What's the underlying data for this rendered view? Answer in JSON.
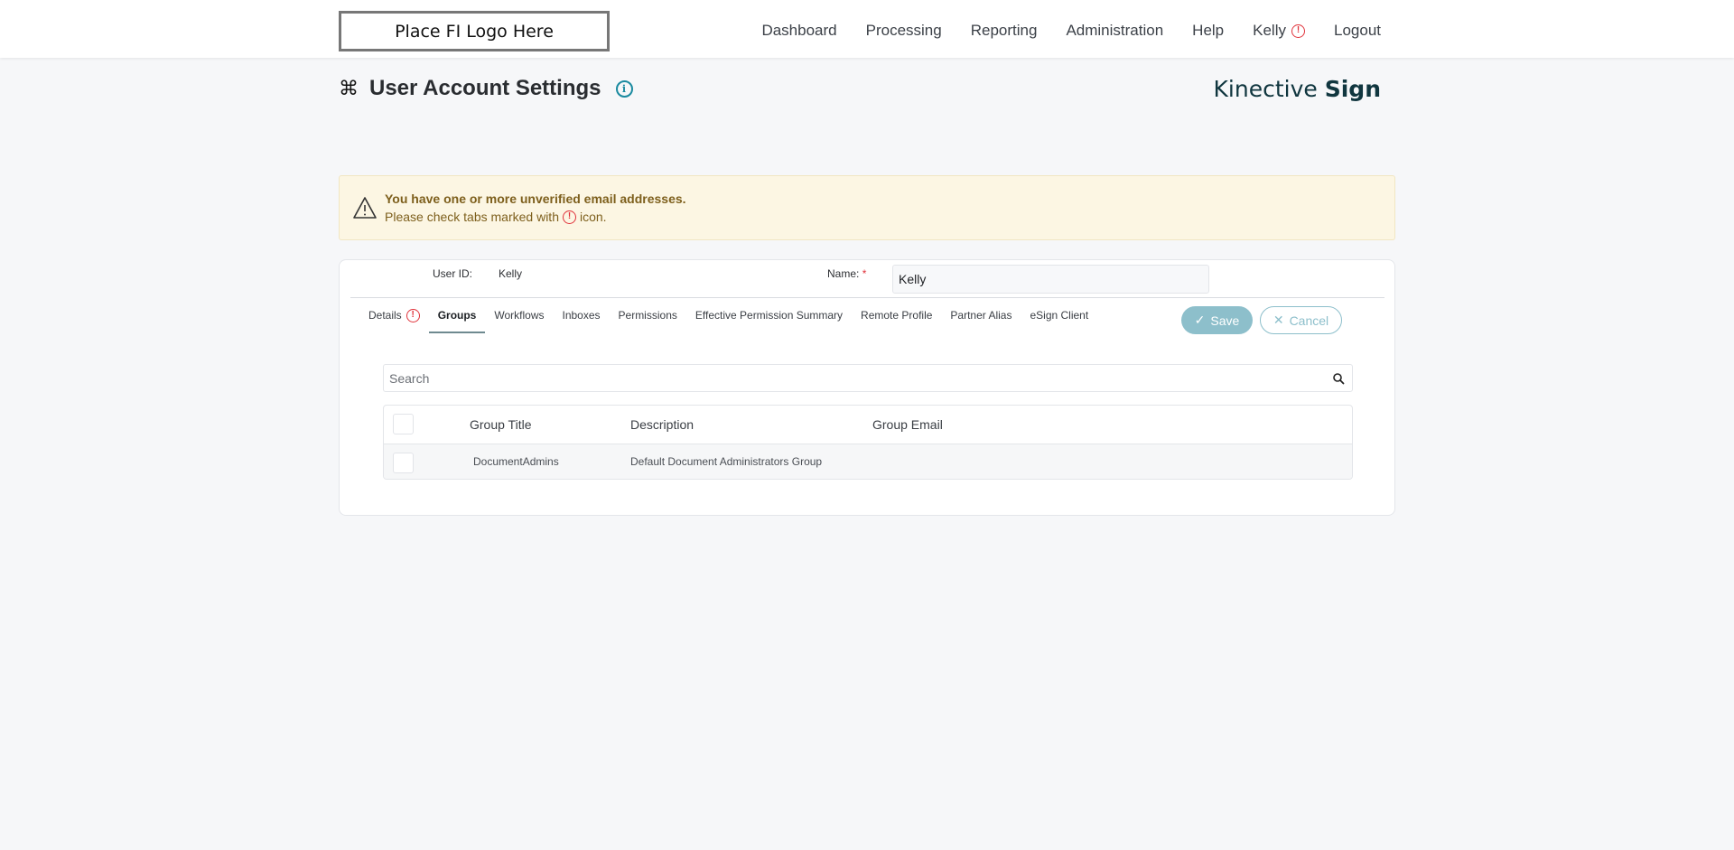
{
  "topbar": {
    "logo_text": "Place FI Logo Here",
    "nav": [
      {
        "label": "Dashboard"
      },
      {
        "label": "Processing"
      },
      {
        "label": "Reporting"
      },
      {
        "label": "Administration"
      },
      {
        "label": "Help"
      },
      {
        "label": "Kelly",
        "alert": true
      },
      {
        "label": "Logout"
      }
    ]
  },
  "header": {
    "title": "User Account Settings",
    "brand_light": "Kinective",
    "brand_bold": "Sign"
  },
  "warning": {
    "title": "You have one or more unverified email addresses.",
    "text_before": "Please check tabs marked with",
    "text_after": "icon."
  },
  "user": {
    "id_label": "User ID:",
    "id_value": "Kelly",
    "name_label": "Name:",
    "name_required": "*",
    "name_value": "Kelly"
  },
  "tabs": [
    {
      "label": "Details",
      "alert": true
    },
    {
      "label": "Groups",
      "active": true
    },
    {
      "label": "Workflows"
    },
    {
      "label": "Inboxes"
    },
    {
      "label": "Permissions"
    },
    {
      "label": "Effective Permission Summary"
    },
    {
      "label": "Remote Profile"
    },
    {
      "label": "Partner Alias"
    },
    {
      "label": "eSign Client"
    }
  ],
  "actions": {
    "save_label": "Save",
    "cancel_label": "Cancel"
  },
  "search": {
    "placeholder": "Search"
  },
  "groups_table": {
    "columns": [
      "Group Title",
      "Description",
      "Group Email"
    ],
    "rows": [
      {
        "title": "DocumentAdmins",
        "description": "Default Document Administrators Group",
        "email": ""
      }
    ]
  },
  "colors": {
    "alert": "#e0323a",
    "accent": "#8dbfcb",
    "info": "#1a8aa0",
    "warning_bg": "#fcf6e3",
    "warning_text": "#7d5f1c"
  }
}
